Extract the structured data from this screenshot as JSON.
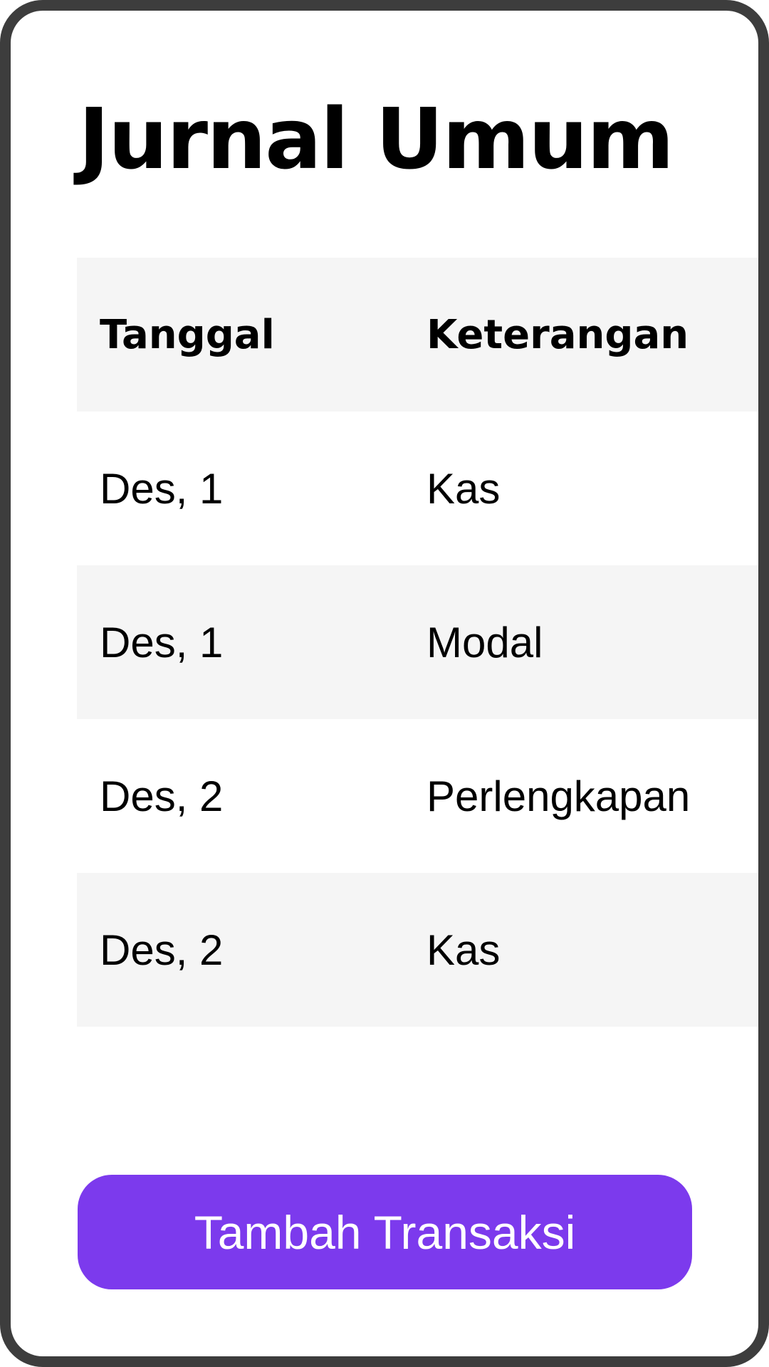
{
  "page": {
    "title": "Jurnal Umum"
  },
  "table": {
    "headers": {
      "date": "Tanggal",
      "description": "Keterangan"
    },
    "rows": [
      {
        "date": "Des, 1",
        "description": "Kas"
      },
      {
        "date": "Des, 1",
        "description": "Modal"
      },
      {
        "date": "Des, 2",
        "description": "Perlengkapan"
      },
      {
        "date": "Des, 2",
        "description": "Kas"
      }
    ]
  },
  "actions": {
    "add_transaction_label": "Tambah Transaksi"
  },
  "colors": {
    "accent": "#7c3aed",
    "row_shade": "#f5f5f5",
    "frame": "#3d3d3d"
  }
}
